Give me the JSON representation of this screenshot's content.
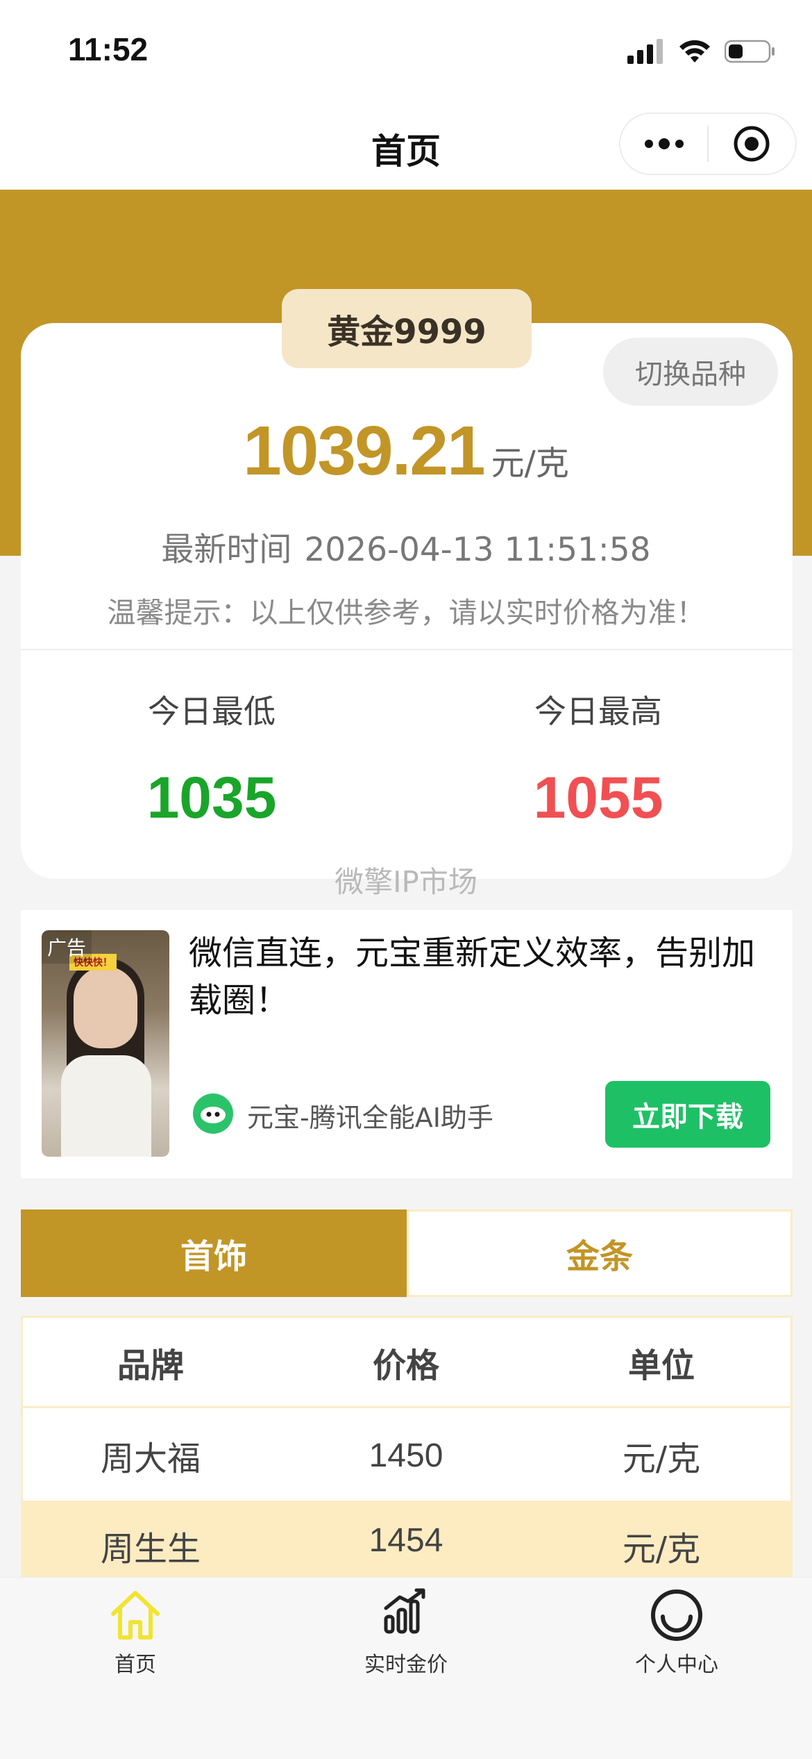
{
  "status_bar": {
    "time": "11:52"
  },
  "nav": {
    "title": "首页"
  },
  "price_card": {
    "variety": "黄金9999",
    "switch_label": "切换品种",
    "price": "1039.21",
    "price_unit": "元/克",
    "updated_label": "最新时间",
    "updated_value": "2026-04-13 11:51:58",
    "notice": "温馨提示：以上仅供参考，请以实时价格为准！",
    "low_label": "今日最低",
    "low_value": "1035",
    "high_label": "今日最高",
    "high_value": "1055",
    "low_color": "#1aa52a",
    "high_color": "#f05052"
  },
  "watermark": "微擎IP市场",
  "ad": {
    "tag": "广告",
    "title": "微信直连，元宝重新定义效率，告别加载圈！",
    "app_name": "元宝-腾讯全能AI助手",
    "cta": "立即下载"
  },
  "tabs": [
    "首饰",
    "金条"
  ],
  "table": {
    "headers": [
      "品牌",
      "价格",
      "单位"
    ],
    "rows": [
      [
        "周大福",
        "1450",
        "元/克"
      ],
      [
        "周生生",
        "1454",
        "元/克"
      ]
    ]
  },
  "tabbar": [
    {
      "label": "首页",
      "icon": "home-icon",
      "active": true
    },
    {
      "label": "实时金价",
      "icon": "chart-icon",
      "active": false
    },
    {
      "label": "个人中心",
      "icon": "smile-icon",
      "active": false
    }
  ],
  "colors": {
    "gold": "#c29527",
    "active_tab_icon": "#f1e432"
  }
}
